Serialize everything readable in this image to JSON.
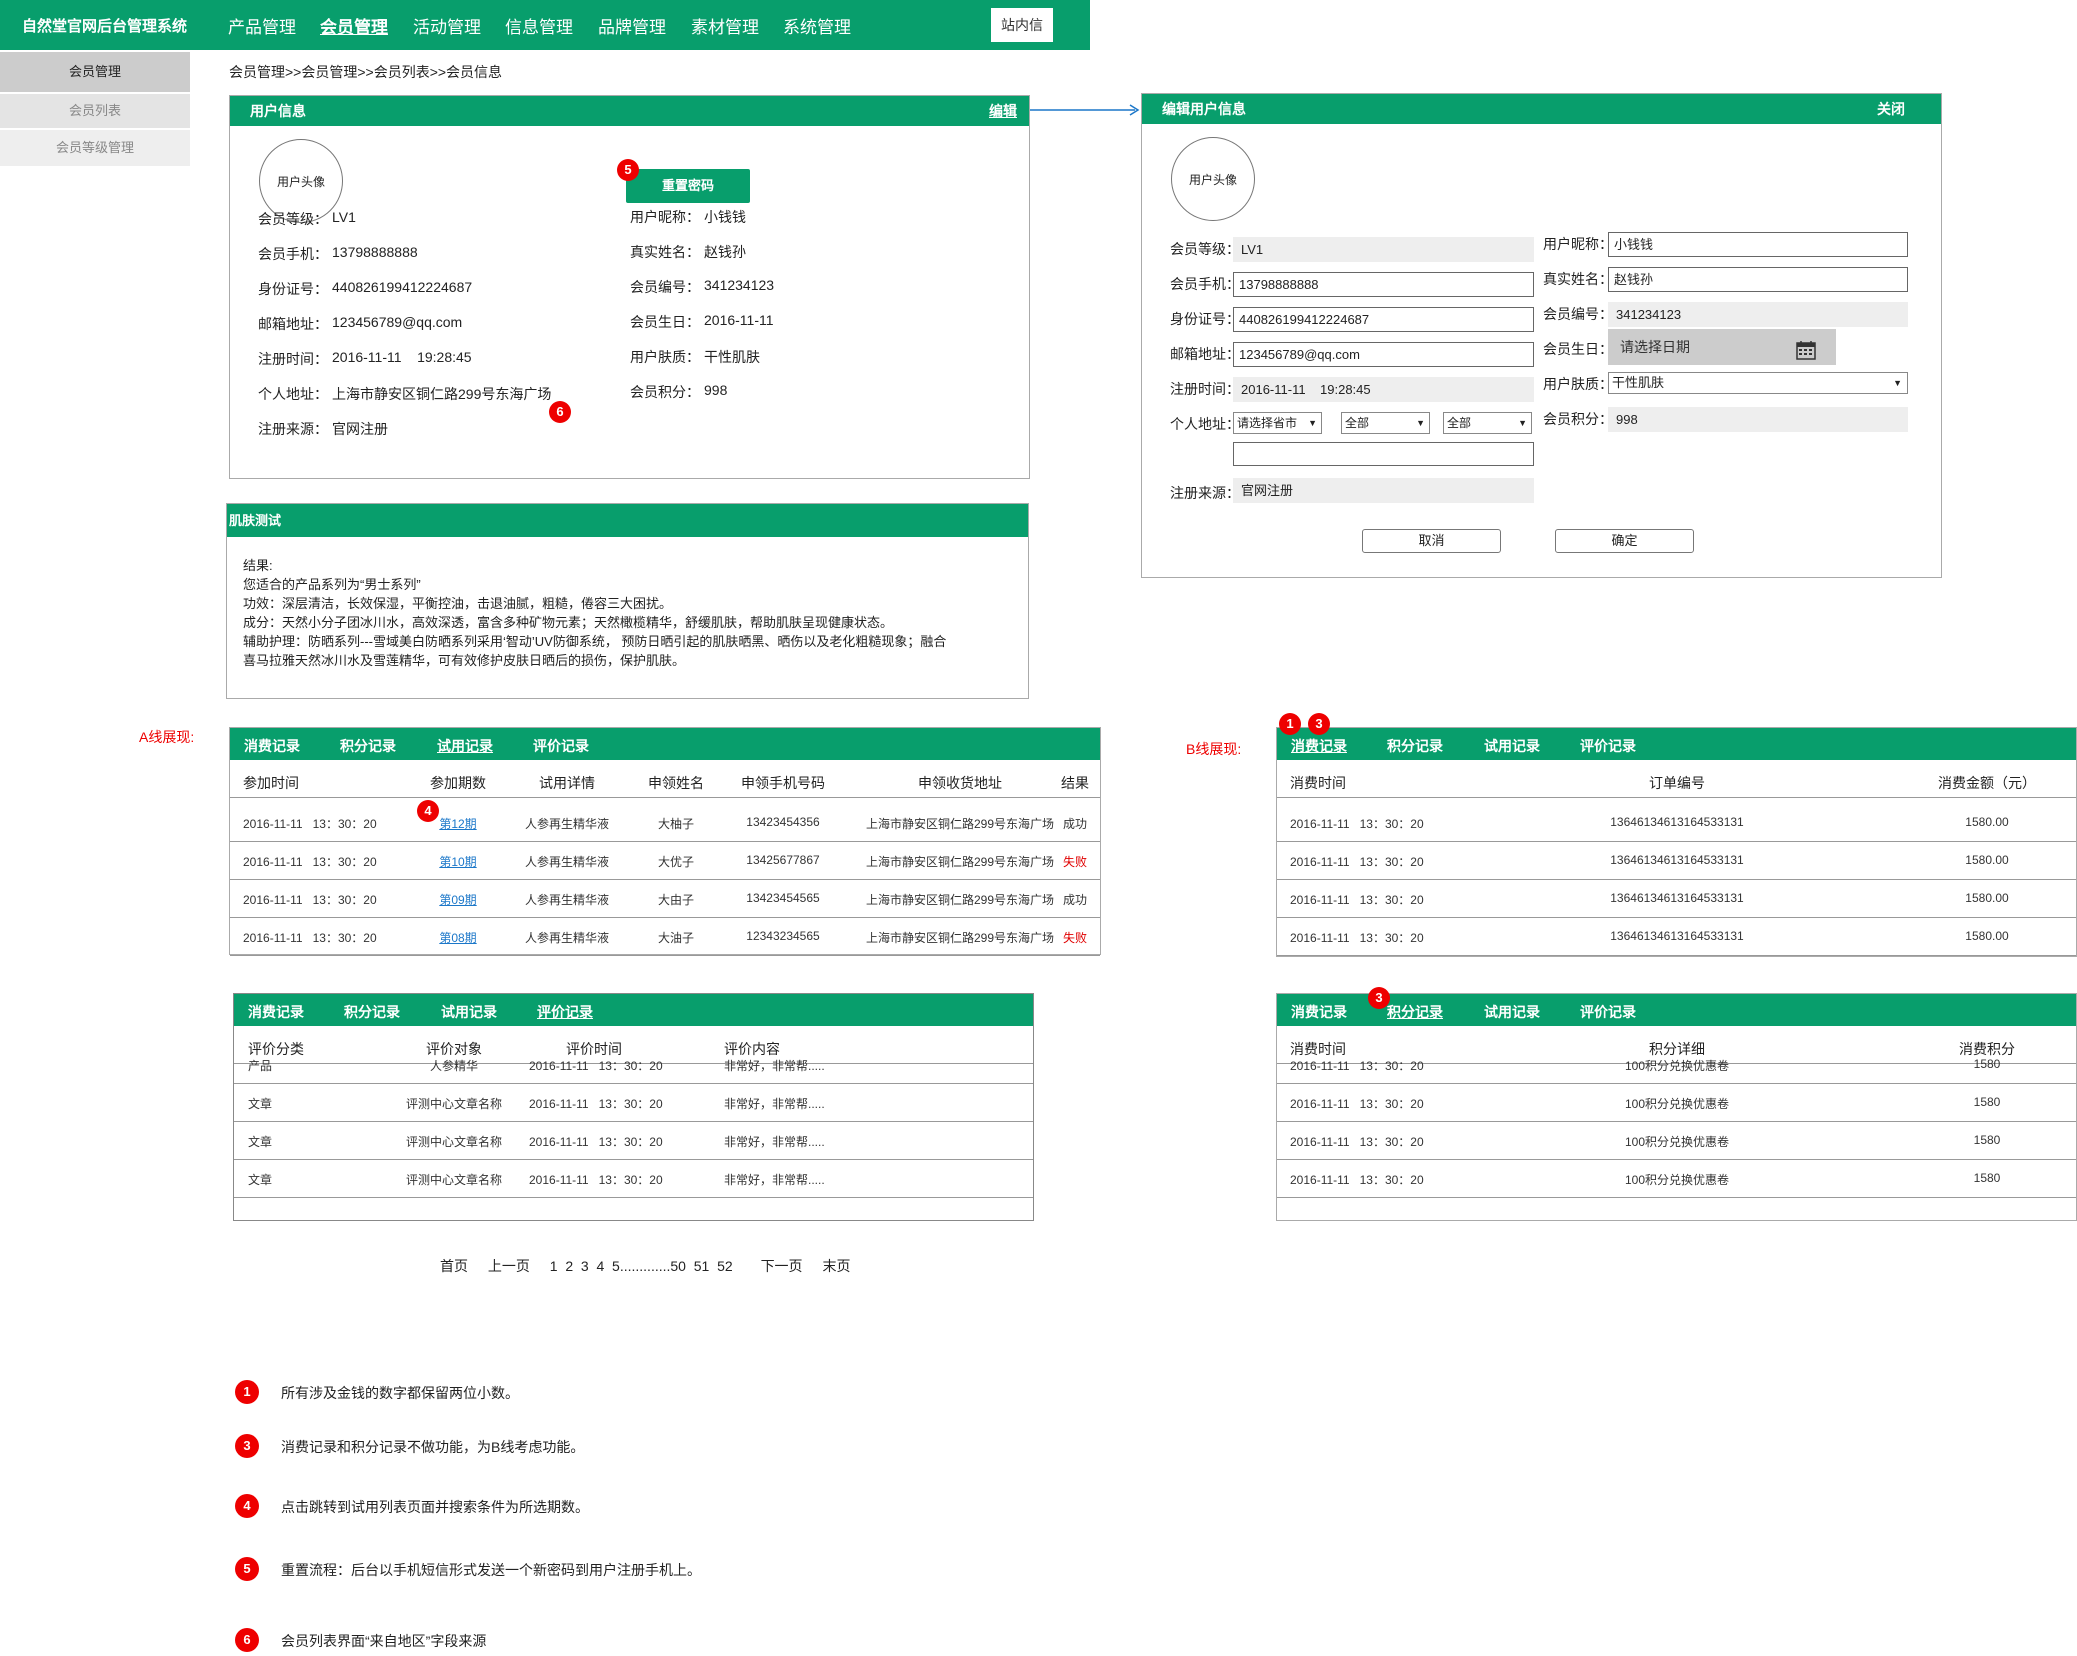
{
  "header": {
    "system_title": "自然堂官网后台管理系统",
    "nav": [
      "产品管理",
      "会员管理",
      "活动管理",
      "信息管理",
      "品牌管理",
      "素材管理",
      "系统管理"
    ],
    "message_button": "站内信"
  },
  "sidebar": {
    "title": "会员管理",
    "items": [
      "会员列表",
      "会员等级管理"
    ]
  },
  "breadcrumb": "会员管理>>会员管理>>会员列表>>会员信息",
  "user_info": {
    "title": "用户信息",
    "edit_link": "编辑",
    "avatar": "用户头像",
    "reset_password": "重置密码",
    "left": [
      {
        "label": "会员等级：",
        "value": "LV1"
      },
      {
        "label": "会员手机：",
        "value": "13798888888"
      },
      {
        "label": "身份证号：",
        "value": "440826199412224687"
      },
      {
        "label": "邮箱地址：",
        "value": "123456789@qq.com"
      },
      {
        "label": "注册时间：",
        "value": "2016-11-11    19:28:45"
      },
      {
        "label": "个人地址：",
        "value": "上海市静安区铜仁路299号东海广场"
      },
      {
        "label": "注册来源：",
        "value": "官网注册"
      }
    ],
    "right": [
      {
        "label": "用户昵称：",
        "value": "小钱钱"
      },
      {
        "label": "真实姓名：",
        "value": "赵钱孙"
      },
      {
        "label": "会员编号：",
        "value": "341234123"
      },
      {
        "label": "会员生日：",
        "value": "2016-11-11"
      },
      {
        "label": "用户肤质：",
        "value": "干性肌肤"
      },
      {
        "label": "会员积分：",
        "value": "998"
      }
    ]
  },
  "skin_test": {
    "title": "肌肤测试",
    "lines": [
      "结果:",
      "您适合的产品系列为“男士系列”",
      "功效：深层清洁，长效保湿，平衡控油，击退油腻，粗糙，倦容三大困扰。",
      "成分：天然小分子团冰川水，高效深透，富含多种矿物元素；天然橄榄精华，舒缓肌肤，帮助肌肤呈现健康状态。",
      "辅助护理：防晒系列---雪域美白防晒系列采用‘智动’UV防御系统， 预防日晒引起的肌肤晒黑、晒伤以及老化粗糙现象；融合",
      "喜马拉雅天然冰川水及雪莲精华，可有效修护皮肤日晒后的损伤，保护肌肤。"
    ]
  },
  "edit_panel": {
    "title": "编辑用户信息",
    "close": "关闭",
    "avatar": "用户头像",
    "left": [
      {
        "label": "会员等级：",
        "value": "LV1",
        "type": "ro"
      },
      {
        "label": "会员手机：",
        "value": "13798888888",
        "type": "input"
      },
      {
        "label": "身份证号：",
        "value": "440826199412224687",
        "type": "input"
      },
      {
        "label": "邮箱地址：",
        "value": "123456789@qq.com",
        "type": "input"
      },
      {
        "label": "注册时间：",
        "value": "2016-11-11    19:28:45",
        "type": "ro"
      }
    ],
    "address_label": "个人地址：",
    "address_selects": [
      "请选择省市",
      "全部",
      "全部"
    ],
    "source_label": "注册来源：",
    "source_value": "官网注册",
    "right": [
      {
        "label": "用户昵称：",
        "value": "小钱钱"
      },
      {
        "label": "真实姓名：",
        "value": "赵钱孙"
      },
      {
        "label": "会员编号：",
        "value": "341234123"
      },
      {
        "label": "会员生日：",
        "value": "请选择日期"
      },
      {
        "label": "用户肤质：",
        "value": "干性肌肤"
      },
      {
        "label": "会员积分：",
        "value": "998"
      }
    ],
    "cancel": "取消",
    "confirm": "确定"
  },
  "tabs": [
    "消费记录",
    "积分记录",
    "试用记录",
    "评价记录"
  ],
  "a_line_label": "A线展现:",
  "b_line_label": "B线展现:",
  "trial_table": {
    "headers": [
      "参加时间",
      "参加期数",
      "试用详情",
      "申领姓名",
      "申领手机号码",
      "申领收货地址",
      "结果"
    ],
    "rows": [
      [
        "2016-11-11   13：30：20",
        "第12期",
        "人参再生精华液",
        "大柚子",
        "13423454356",
        "上海市静安区铜仁路299号东海广场",
        "成功"
      ],
      [
        "2016-11-11   13：30：20",
        "第10期",
        "人参再生精华液",
        "大优子",
        "13425677867",
        "上海市静安区铜仁路299号东海广场",
        "失败"
      ],
      [
        "2016-11-11   13：30：20",
        "第09期",
        "人参再生精华液",
        "大由子",
        "13423454565",
        "上海市静安区铜仁路299号东海广场",
        "成功"
      ],
      [
        "2016-11-11   13：30：20",
        "第08期",
        "人参再生精华液",
        "大油子",
        "12343234565",
        "上海市静安区铜仁路299号东海广场",
        "失败"
      ]
    ],
    "fail_color": "#e00000"
  },
  "review_table": {
    "headers": [
      "评价分类",
      "评价对象",
      "评价时间",
      "评价内容"
    ],
    "rows": [
      [
        "产品",
        "人参精华",
        "2016-11-11   13：30：20",
        "非常好，非常帮....."
      ],
      [
        "文章",
        "评测中心文章名称",
        "2016-11-11   13：30：20",
        "非常好，非常帮....."
      ],
      [
        "文章",
        "评测中心文章名称",
        "2016-11-11   13：30：20",
        "非常好，非常帮....."
      ],
      [
        "文章",
        "评测中心文章名称",
        "2016-11-11   13：30：20",
        "非常好，非常帮....."
      ]
    ]
  },
  "pagination": [
    "首页",
    "上一页",
    "1  2  3  4  5.............50  51  52",
    "下一页",
    "末页"
  ],
  "consume_table": {
    "headers": [
      "消费时间",
      "订单编号",
      "消费金额（元）"
    ],
    "rows": [
      [
        "2016-11-11   13：30：20",
        "13646134613164533131",
        "1580.00"
      ],
      [
        "2016-11-11   13：30：20",
        "13646134613164533131",
        "1580.00"
      ],
      [
        "2016-11-11   13：30：20",
        "13646134613164533131",
        "1580.00"
      ],
      [
        "2016-11-11   13：30：20",
        "13646134613164533131",
        "1580.00"
      ]
    ]
  },
  "points_table": {
    "headers": [
      "消费时间",
      "积分详细",
      "消费积分"
    ],
    "rows": [
      [
        "2016-11-11   13：30：20",
        "100积分兑换优惠卷",
        "1580"
      ],
      [
        "2016-11-11   13：30：20",
        "100积分兑换优惠卷",
        "1580"
      ],
      [
        "2016-11-11   13：30：20",
        "100积分兑换优惠卷",
        "1580"
      ],
      [
        "2016-11-11   13：30：20",
        "100积分兑换优惠卷",
        "1580"
      ]
    ]
  },
  "badges": {
    "b1": "1",
    "b3": "3",
    "b4": "4",
    "b5": "5",
    "b6": "6"
  },
  "notes": [
    {
      "num": "1",
      "text": "所有涉及金钱的数字都保留两位小数。"
    },
    {
      "num": "3",
      "text": "消费记录和积分记录不做功能，为B线考虑功能。"
    },
    {
      "num": "4",
      "text": "点击跳转到试用列表页面并搜索条件为所选期数。"
    },
    {
      "num": "5",
      "text": "重置流程：后台以手机短信形式发送一个新密码到用户注册手机上。"
    },
    {
      "num": "6",
      "text": "会员列表界面“来自地区”字段来源"
    }
  ],
  "colors": {
    "brand_green": "#089e6c",
    "badge_red": "#e00000",
    "link_blue": "#1b77c9"
  }
}
